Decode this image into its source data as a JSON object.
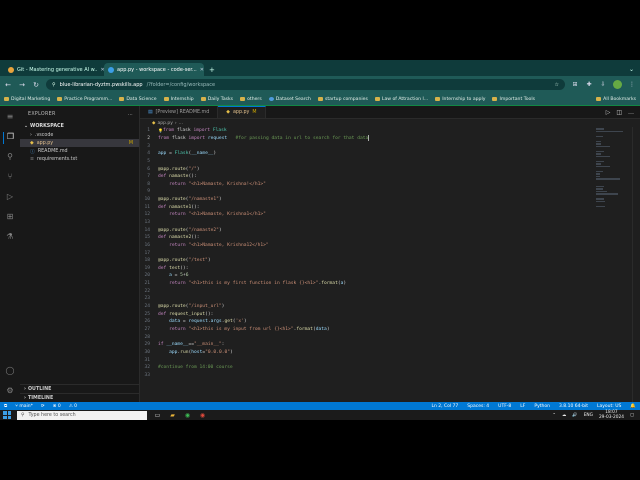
{
  "browser": {
    "tabs": [
      {
        "label": "Git - Mastering generative AI w..",
        "active": false
      },
      {
        "label": "app.py - workspace - code-ser...",
        "active": true
      }
    ],
    "address": {
      "host": "blue-librarian-dyztm.pwskills.app",
      "path": "/?folder=/config/workspace"
    },
    "bookmarks": [
      "Digital Marketing",
      "Practice Programm...",
      "Data Science",
      "Internship",
      "Daily Tasks",
      "others",
      "Dataset Search",
      "startup companies",
      "Law of Attraction l...",
      "Internship to apply",
      "Important Tools"
    ],
    "all_bookmarks": "All Bookmarks"
  },
  "explorer": {
    "title": "EXPLORER",
    "workspace": "WORKSPACE",
    "items": [
      {
        "name": ".vscode",
        "type": "folder",
        "badge": ""
      },
      {
        "name": "app.py",
        "type": "py",
        "badge": "M",
        "selected": true
      },
      {
        "name": "README.md",
        "type": "md",
        "badge": ""
      },
      {
        "name": "requirements.txt",
        "type": "txt",
        "badge": ""
      }
    ],
    "outline": "OUTLINE",
    "timeline": "TIMELINE"
  },
  "editor": {
    "tabs": [
      {
        "label": "[Preview] README.md",
        "active": false,
        "modified": ""
      },
      {
        "label": "app.py",
        "active": true,
        "modified": "M"
      }
    ],
    "breadcrumb": [
      "app.py",
      "..."
    ],
    "lines": [
      [
        [
          "kw",
          "from"
        ],
        [
          "txt",
          " flask "
        ],
        [
          "kw",
          "import"
        ],
        [
          "cls",
          " Flask"
        ]
      ],
      [
        [
          "kw",
          "from"
        ],
        [
          "txt",
          " flask "
        ],
        [
          "kw",
          "import"
        ],
        [
          "var",
          " request"
        ],
        [
          "txt",
          "   "
        ],
        [
          "cmt",
          "#for passing data in url to search for that data"
        ]
      ],
      [],
      [
        [
          "var",
          "app"
        ],
        [
          "txt",
          " = "
        ],
        [
          "cls",
          "Flask"
        ],
        [
          "txt",
          "("
        ],
        [
          "var",
          "__name__"
        ],
        [
          "txt",
          ")"
        ]
      ],
      [],
      [
        [
          "dec",
          "@app.route"
        ],
        [
          "txt",
          "("
        ],
        [
          "str",
          "\"/\""
        ],
        [
          "txt",
          ")"
        ]
      ],
      [
        [
          "kw",
          "def"
        ],
        [
          "fn",
          " namaste"
        ],
        [
          "txt",
          "():"
        ]
      ],
      [
        [
          "txt",
          "    "
        ],
        [
          "kw",
          "return"
        ],
        [
          "str",
          " \"<h1>Namaste, Krishna!</h1>\""
        ]
      ],
      [],
      [
        [
          "dec",
          "@app.route"
        ],
        [
          "txt",
          "("
        ],
        [
          "str",
          "\"/namaste1\""
        ],
        [
          "txt",
          ")"
        ]
      ],
      [
        [
          "kw",
          "def"
        ],
        [
          "fn",
          " namaste1"
        ],
        [
          "txt",
          "():"
        ]
      ],
      [
        [
          "txt",
          "    "
        ],
        [
          "kw",
          "return"
        ],
        [
          "str",
          " \"<h1>Namaste, Krishna1</h1>\""
        ]
      ],
      [],
      [
        [
          "dec",
          "@app.route"
        ],
        [
          "txt",
          "("
        ],
        [
          "str",
          "\"/namaste2\""
        ],
        [
          "txt",
          ")"
        ]
      ],
      [
        [
          "kw",
          "def"
        ],
        [
          "fn",
          " namaste2"
        ],
        [
          "txt",
          "():"
        ]
      ],
      [
        [
          "txt",
          "    "
        ],
        [
          "kw",
          "return"
        ],
        [
          "str",
          " \"<h1>Namaste, Krishna12</h1>\""
        ]
      ],
      [],
      [
        [
          "dec",
          "@app.route"
        ],
        [
          "txt",
          "("
        ],
        [
          "str",
          "\"/test\""
        ],
        [
          "txt",
          ")"
        ]
      ],
      [
        [
          "kw",
          "def"
        ],
        [
          "fn",
          " test"
        ],
        [
          "txt",
          "():"
        ]
      ],
      [
        [
          "txt",
          "    "
        ],
        [
          "var",
          "a"
        ],
        [
          "txt",
          " = "
        ],
        [
          "num",
          "5"
        ],
        [
          "txt",
          "+"
        ],
        [
          "num",
          "6"
        ]
      ],
      [
        [
          "txt",
          "    "
        ],
        [
          "kw",
          "return"
        ],
        [
          "str",
          " \"<h1>this is my first function in flask {}<h1>\""
        ],
        [
          "txt",
          "."
        ],
        [
          "fn",
          "format"
        ],
        [
          "txt",
          "("
        ],
        [
          "var",
          "a"
        ],
        [
          "txt",
          ")"
        ]
      ],
      [],
      [],
      [
        [
          "dec",
          "@app.route"
        ],
        [
          "txt",
          "("
        ],
        [
          "str",
          "\"/input_url\""
        ],
        [
          "txt",
          ")"
        ]
      ],
      [
        [
          "kw",
          "def"
        ],
        [
          "fn",
          " request_input"
        ],
        [
          "txt",
          "():"
        ]
      ],
      [
        [
          "txt",
          "    "
        ],
        [
          "var",
          "data"
        ],
        [
          "txt",
          " = "
        ],
        [
          "var",
          "request"
        ],
        [
          "txt",
          "."
        ],
        [
          "var",
          "args"
        ],
        [
          "txt",
          "."
        ],
        [
          "fn",
          "get"
        ],
        [
          "txt",
          "("
        ],
        [
          "str",
          "'x'"
        ],
        [
          "txt",
          ")"
        ]
      ],
      [
        [
          "txt",
          "    "
        ],
        [
          "kw",
          "return"
        ],
        [
          "str",
          " \"<h1>this is my input from url {}<h1>\""
        ],
        [
          "txt",
          "."
        ],
        [
          "fn",
          "format"
        ],
        [
          "txt",
          "("
        ],
        [
          "var",
          "data"
        ],
        [
          "txt",
          ")"
        ]
      ],
      [],
      [
        [
          "kw",
          "if"
        ],
        [
          "var",
          " __name__"
        ],
        [
          "txt",
          "=="
        ],
        [
          "str",
          "\"__main__\""
        ],
        [
          "txt",
          ":"
        ]
      ],
      [
        [
          "txt",
          "    "
        ],
        [
          "var",
          "app"
        ],
        [
          "txt",
          "."
        ],
        [
          "fn",
          "run"
        ],
        [
          "txt",
          "("
        ],
        [
          "var",
          "host"
        ],
        [
          "txt",
          "="
        ],
        [
          "str",
          "\"0.0.0.0\""
        ],
        [
          "txt",
          ")"
        ]
      ],
      [],
      [
        [
          "cmt",
          "#continue from 14:00 course"
        ]
      ],
      []
    ]
  },
  "status": {
    "branch": "main*",
    "sync": "⟳",
    "errors": "⊗ 0",
    "warnings": "⚠ 0",
    "position": "Ln 2, Col 77",
    "spaces": "Spaces: 4",
    "encoding": "UTF-8",
    "eol": "LF",
    "language": "Python",
    "interpreter": "3.8.10 64-bit",
    "layout": "Layout: US"
  },
  "taskbar": {
    "search_placeholder": "Type here to search",
    "lang": "ENG",
    "time": "18:07",
    "date": "29-03-2024"
  },
  "colors": {
    "accent": "#0078d4",
    "browser_frame": "#1f5a57"
  }
}
